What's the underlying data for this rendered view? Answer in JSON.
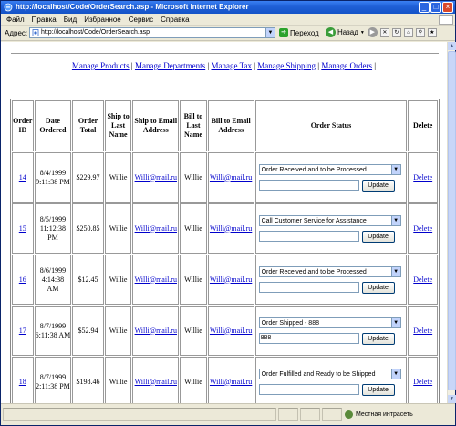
{
  "window": {
    "title": "http://localhost/Code/OrderSearch.asp - Microsoft Internet Explorer",
    "controls": [
      "_",
      "□",
      "×"
    ]
  },
  "menubar": {
    "items": [
      "Файл",
      "Правка",
      "Вид",
      "Избранное",
      "Сервис",
      "Справка"
    ]
  },
  "addressbar": {
    "label": "Адрес:",
    "url": "http://localhost/Code/OrderSearch.asp",
    "go_label": "Переход",
    "back_label": "Назад"
  },
  "nav": {
    "links": [
      "Manage Products",
      "Manage Departments",
      "Manage Tax",
      "Manage Shipping",
      "Manage Orders"
    ],
    "separator": "|"
  },
  "table": {
    "headers": [
      "Order ID",
      "Date Ordered",
      "Order Total",
      "Ship to Last Name",
      "Ship to Email Address",
      "Bill to Last Name",
      "Bill to Email Address",
      "Order Status",
      "Delete"
    ],
    "update_label": "Update",
    "delete_label": "Delete",
    "rows": [
      {
        "id": "14",
        "date": "8/4/1999 9:11:38 PM",
        "total": "$229.97",
        "ship_last": "Willie",
        "ship_email": "Willi@mail.ru",
        "bill_last": "Willie",
        "bill_email": "Willi@mail.ru",
        "status": "Order Received and to be Processed",
        "note": ""
      },
      {
        "id": "15",
        "date": "8/5/1999 11:12:38 PM",
        "total": "$250.85",
        "ship_last": "Willie",
        "ship_email": "Willi@mail.ru",
        "bill_last": "Willie",
        "bill_email": "Willi@mail.ru",
        "status": "Call Customer Service for Assistance",
        "note": ""
      },
      {
        "id": "16",
        "date": "8/6/1999 4:14:38 AM",
        "total": "$12.45",
        "ship_last": "Willie",
        "ship_email": "Willi@mail.ru",
        "bill_last": "Willie",
        "bill_email": "Willi@mail.ru",
        "status": "Order Received and to be Processed",
        "note": ""
      },
      {
        "id": "17",
        "date": "8/7/1999 6:11:38 AM",
        "total": "$52.94",
        "ship_last": "Willie",
        "ship_email": "Willi@mail.ru",
        "bill_last": "Willie",
        "bill_email": "Willi@mail.ru",
        "status": "Order Shipped - 888",
        "note": "888"
      },
      {
        "id": "18",
        "date": "8/7/1999 2:11:38 PM",
        "total": "$198.46",
        "ship_last": "Willie",
        "ship_email": "Willi@mail.ru",
        "bill_last": "Willie",
        "bill_email": "Willi@mail.ru",
        "status": "Order Fulfilled and Ready to be Shipped",
        "note": ""
      }
    ]
  },
  "statusbar": {
    "zone_label": "Местная интрасеть"
  },
  "colors": {
    "titlebar": "#1f5fd6",
    "link": "#0000cc",
    "chrome": "#ece9d8"
  },
  "icons": [
    "ie-logo-icon",
    "page-icon",
    "go-arrow-icon",
    "back-arrow-icon",
    "forward-arrow-icon",
    "stop-icon",
    "refresh-icon",
    "home-icon",
    "search-icon",
    "favorites-icon",
    "zone-icon"
  ]
}
